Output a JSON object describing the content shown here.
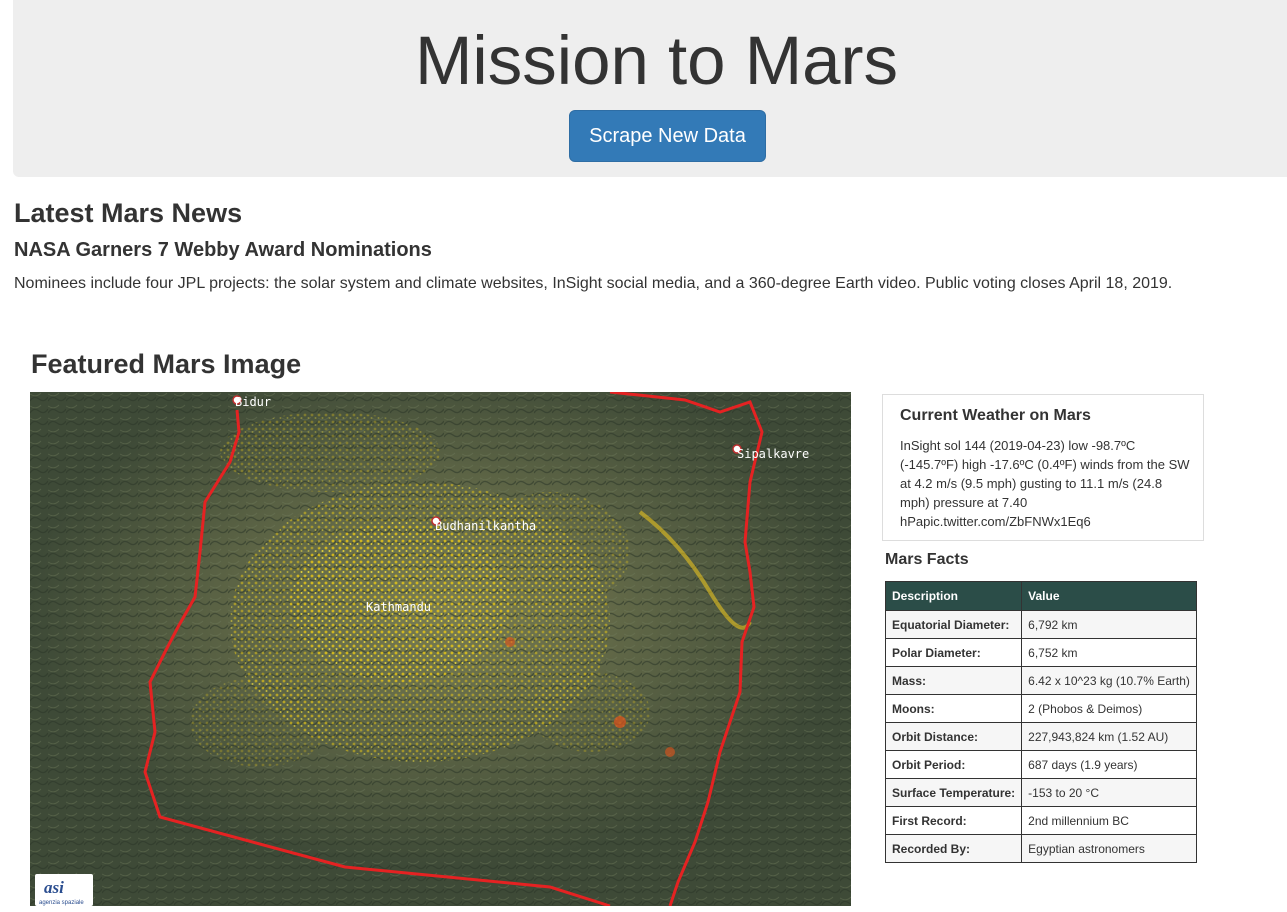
{
  "header": {
    "title": "Mission to Mars",
    "scrape_button": "Scrape New Data"
  },
  "news": {
    "heading": "Latest Mars News",
    "title": "NASA Garners 7 Webby Award Nominations",
    "paragraph": "Nominees include four JPL projects: the solar system and climate websites, InSight social media, and a 360-degree Earth video. Public voting closes April 18, 2019."
  },
  "featured_image": {
    "heading": "Featured Mars Image",
    "map_labels": {
      "bidur": "Bidur",
      "sipalkavre": "Sipalkavre",
      "budhanilkantha": "Budhanilkantha",
      "kathmandu": "Kathmandu",
      "logo": "asi",
      "logo_caption": "agenzia spaziale"
    }
  },
  "weather": {
    "heading": "Current Weather on Mars",
    "text": "InSight sol 144 (2019-04-23) low -98.7ºC (-145.7ºF) high -17.6ºC (0.4ºF) winds from the SW at 4.2 m/s (9.5 mph) gusting to 11.1 m/s (24.8 mph) pressure at 7.40 hPapic.twitter.com/ZbFNWx1Eq6"
  },
  "facts": {
    "heading": "Mars Facts",
    "columns": [
      "Description",
      "Value"
    ],
    "rows": [
      {
        "label": "Equatorial Diameter:",
        "value": "6,792 km"
      },
      {
        "label": "Polar Diameter:",
        "value": "6,752 km"
      },
      {
        "label": "Mass:",
        "value": "6.42 x 10^23 kg (10.7% Earth)"
      },
      {
        "label": "Moons:",
        "value": "2 (Phobos & Deimos)"
      },
      {
        "label": "Orbit Distance:",
        "value": "227,943,824 km (1.52 AU)"
      },
      {
        "label": "Orbit Period:",
        "value": "687 days (1.9 years)"
      },
      {
        "label": "Surface Temperature:",
        "value": "-153 to 20 °C"
      },
      {
        "label": "First Record:",
        "value": "2nd millennium BC"
      },
      {
        "label": "Recorded By:",
        "value": "Egyptian astronomers"
      }
    ]
  }
}
